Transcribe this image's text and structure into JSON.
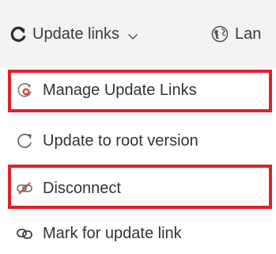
{
  "toolbar": {
    "update_links_label": "Update links",
    "update_links_icon": "refresh-icon",
    "language_label": "Lan",
    "language_icon": "globe-icon"
  },
  "menu": {
    "items": [
      {
        "label": "Manage Update Links",
        "icon": "manage-links-icon",
        "highlighted": true
      },
      {
        "label": "Update to root version",
        "icon": "refresh-outline-icon",
        "highlighted": false
      },
      {
        "label": "Disconnect",
        "icon": "unlink-icon",
        "highlighted": true
      },
      {
        "label": "Mark for update link",
        "icon": "link-icon",
        "highlighted": false
      }
    ]
  },
  "colors": {
    "highlight": "#e0202a",
    "toolbar_bg": "#f3f3f3",
    "icon_accent": "#e0453a"
  }
}
